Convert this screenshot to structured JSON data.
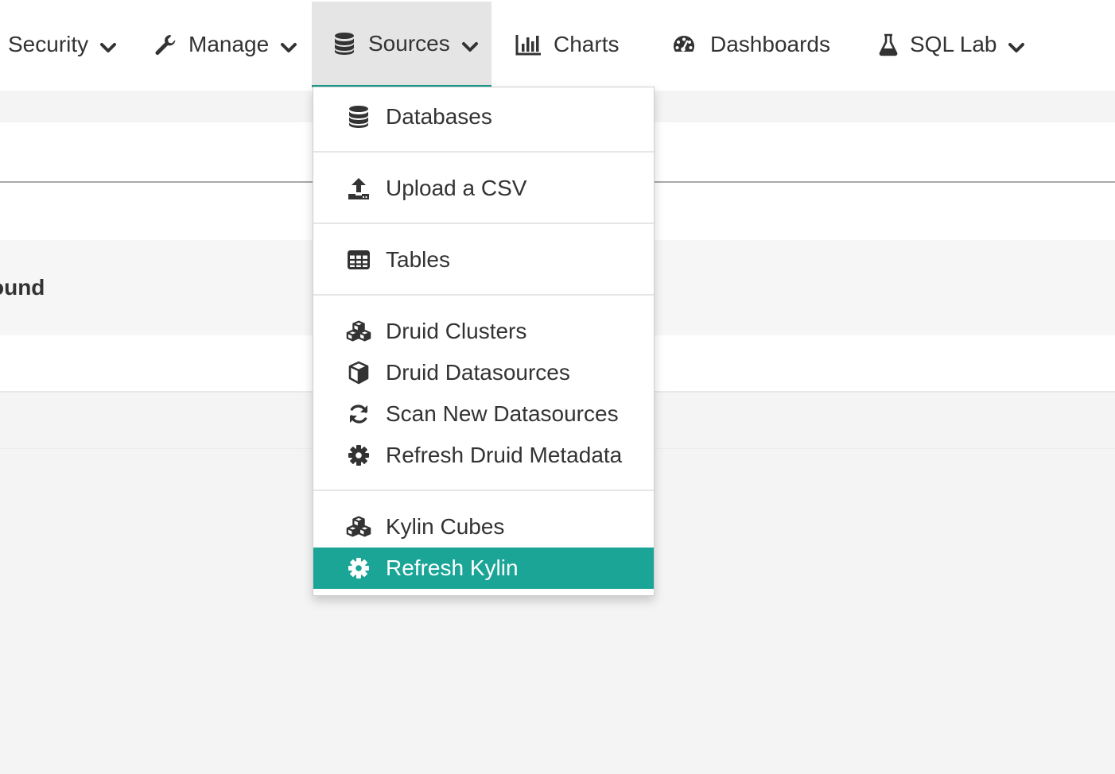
{
  "navbar": {
    "items": [
      {
        "label": "Security",
        "icon": "none",
        "has_caret": true
      },
      {
        "label": "Manage",
        "icon": "wrench-icon",
        "has_caret": true
      },
      {
        "label": "Sources",
        "icon": "database-icon",
        "has_caret": true,
        "active": true
      },
      {
        "label": "Charts",
        "icon": "bar-chart-icon",
        "has_caret": false
      },
      {
        "label": "Dashboards",
        "icon": "dashboard-gauge-icon",
        "has_caret": false
      },
      {
        "label": "SQL Lab",
        "icon": "flask-icon",
        "has_caret": true
      }
    ]
  },
  "background": {
    "partial_text": "ound"
  },
  "sources_menu": {
    "items": [
      {
        "label": "Databases",
        "icon": "database-icon"
      },
      {
        "label": "Upload a CSV",
        "icon": "upload-icon"
      },
      {
        "label": "Tables",
        "icon": "table-icon"
      },
      {
        "label": "Druid Clusters",
        "icon": "cubes-icon"
      },
      {
        "label": "Druid Datasources",
        "icon": "cube-icon"
      },
      {
        "label": "Scan New Datasources",
        "icon": "refresh-icon"
      },
      {
        "label": "Refresh Druid Metadata",
        "icon": "gear-icon"
      },
      {
        "label": "Kylin Cubes",
        "icon": "cubes-icon"
      },
      {
        "label": "Refresh Kylin",
        "icon": "gear-icon",
        "highlighted": true
      }
    ]
  },
  "colors": {
    "accent": "#1aa596",
    "active_tab_bg": "#e5e5e5",
    "text": "#333333"
  }
}
